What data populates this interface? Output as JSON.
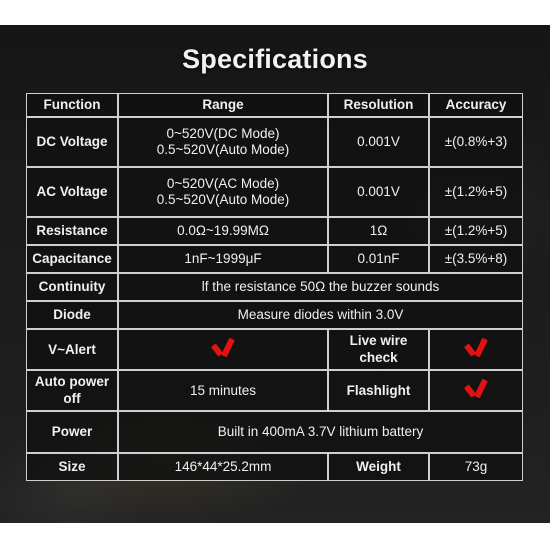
{
  "page": {
    "title": "Specifications",
    "accent_red": "#e21212",
    "panel_bg": "#1b1b1b",
    "border_color": "#cfcfcf",
    "text_color": "#f0f0f0"
  },
  "table": {
    "headers": {
      "function": "Function",
      "range": "Range",
      "resolution": "Resolution",
      "accuracy": "Accuracy"
    },
    "rows": [
      {
        "function": "DC Voltage",
        "range_line1": "0~520V(DC Mode)",
        "range_line2": "0.5~520V(Auto Mode)",
        "resolution": "0.001V",
        "accuracy": "±(0.8%+3)"
      },
      {
        "function": "AC Voltage",
        "range_line1": "0~520V(AC Mode)",
        "range_line2": "0.5~520V(Auto Mode)",
        "resolution": "0.001V",
        "accuracy": "±(1.2%+5)"
      },
      {
        "function": "Resistance",
        "range_line1": "0.0Ω~19.99MΩ",
        "range_line2": "",
        "resolution": "1Ω",
        "accuracy": "±(1.2%+5)"
      },
      {
        "function": "Capacitance",
        "range_line1": "1nF~1999μF",
        "range_line2": "",
        "resolution": "0.01nF",
        "accuracy": "±(3.5%+8)"
      }
    ],
    "continuity": {
      "function": "Continuity",
      "description": "lf the resistance 50Ω the buzzer sounds"
    },
    "diode": {
      "function": "Diode",
      "description": "Measure diodes within 3.0V"
    },
    "feature_rows": [
      {
        "label_left": "V~Alert",
        "value_left": "check-mark",
        "label_right": "Live wire check",
        "value_right": "check-mark"
      },
      {
        "label_left": "Auto power off",
        "value_left": "15 minutes",
        "label_right": "Flashlight",
        "value_right": "check-mark"
      }
    ],
    "power": {
      "label": "Power",
      "value": "Built in 400mA 3.7V lithium battery"
    },
    "size_row": {
      "size_label": "Size",
      "size_value": "146*44*25.2mm",
      "weight_label": "Weight",
      "weight_value": "73g"
    }
  }
}
